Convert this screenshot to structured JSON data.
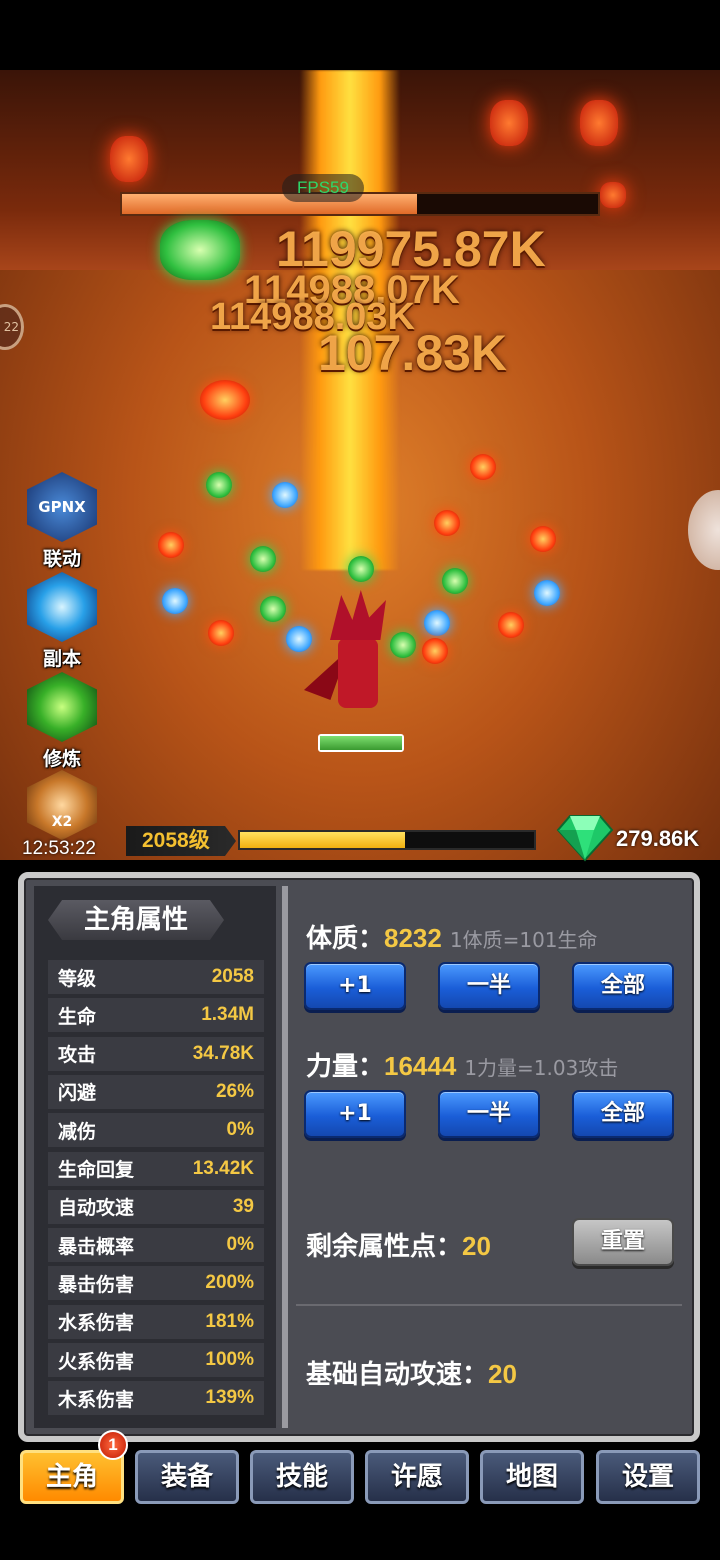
{
  "battle": {
    "fps": "FPS59",
    "damage_numbers": [
      "119975.87K",
      "114988.07K",
      "114988.03K",
      "107.83K"
    ],
    "boss_hp_fraction": 0.62,
    "left_edge_label": "22"
  },
  "side_menu": [
    {
      "label": "联动",
      "icon_text": "GPNX"
    },
    {
      "label": "副本"
    },
    {
      "label": "修炼"
    },
    {
      "icon_text": "X2"
    }
  ],
  "clock": "12:53:22",
  "level": {
    "text": "2058级",
    "xp_fraction": 0.56
  },
  "currency": {
    "gems": "279.86K",
    "gem_color": "#2ee07a"
  },
  "panel": {
    "title": "主角属性",
    "stats": [
      {
        "key": "等级",
        "value": "2058"
      },
      {
        "key": "生命",
        "value": "1.34M"
      },
      {
        "key": "攻击",
        "value": "34.78K"
      },
      {
        "key": "闪避",
        "value": "26%"
      },
      {
        "key": "减伤",
        "value": "0%"
      },
      {
        "key": "生命回复",
        "value": "13.42K"
      },
      {
        "key": "自动攻速",
        "value": "39"
      },
      {
        "key": "暴击概率",
        "value": "0%"
      },
      {
        "key": "暴击伤害",
        "value": "200%"
      },
      {
        "key": "水系伤害",
        "value": "181%"
      },
      {
        "key": "火系伤害",
        "value": "100%"
      },
      {
        "key": "木系伤害",
        "value": "139%"
      }
    ],
    "constitution": {
      "label": "体质：",
      "value": "8232",
      "hint": "1体质=101生命"
    },
    "strength": {
      "label": "力量：",
      "value": "16444",
      "hint": "1力量=1.03攻击"
    },
    "buttons": {
      "plus_one": "+1",
      "half": "一半",
      "all": "全部",
      "reset": "重置"
    },
    "remaining": {
      "label": "剩余属性点：",
      "value": "20"
    },
    "base_speed": {
      "label": "基础自动攻速：",
      "value": "20"
    }
  },
  "tabs": {
    "items": [
      "主角",
      "装备",
      "技能",
      "许愿",
      "地图",
      "设置"
    ],
    "badge": "1",
    "active_color": "#ff9a10"
  }
}
